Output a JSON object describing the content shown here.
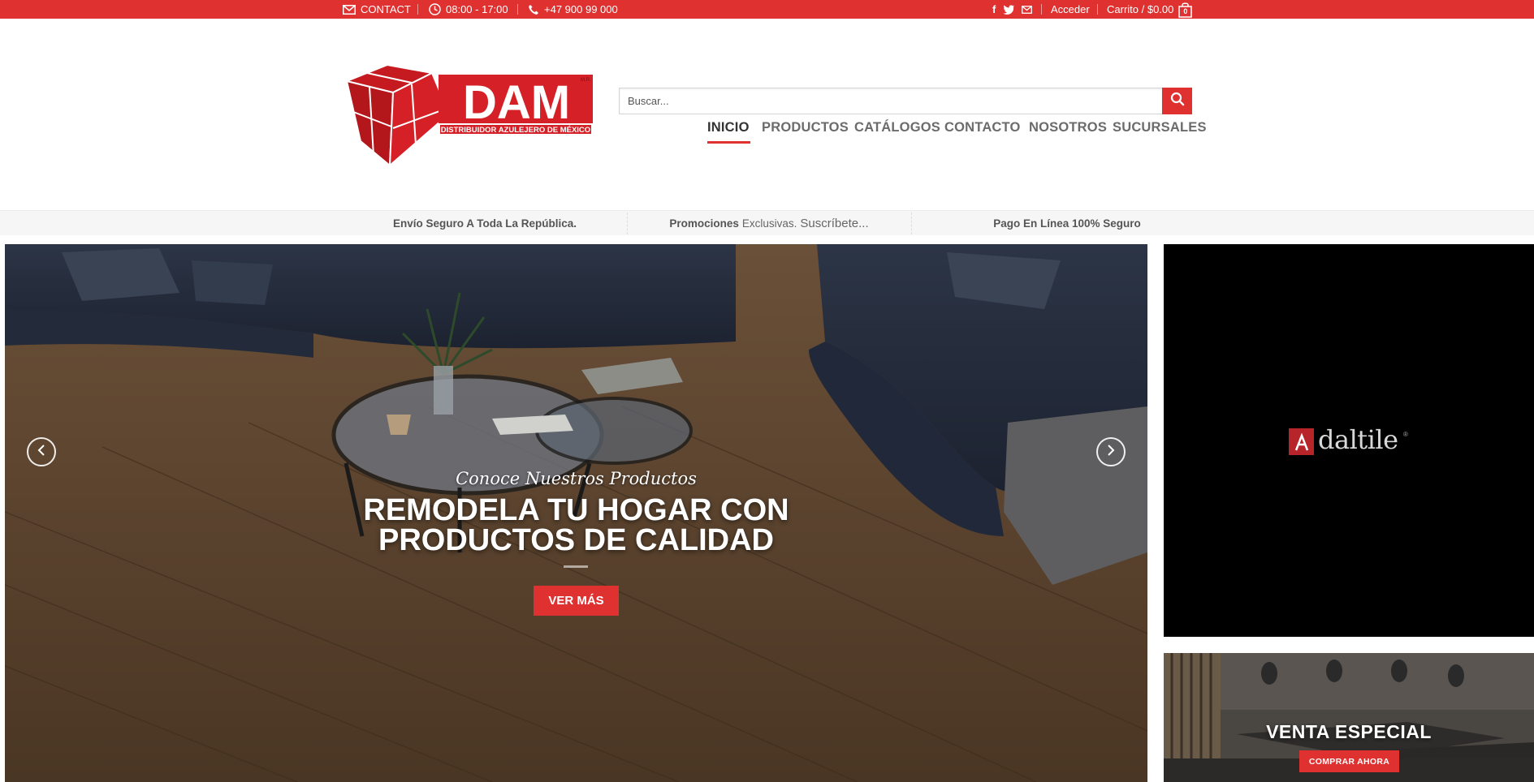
{
  "topbar": {
    "contact_label": "CONTACT",
    "hours": "08:00 - 17:00",
    "phone": "+47 900 99 000",
    "social_icons": [
      "facebook-icon",
      "twitter-icon",
      "envelope-icon"
    ],
    "login_label": "Acceder",
    "cart_label": "Carrito / $0.00",
    "cart_count": "0"
  },
  "header": {
    "logo": {
      "brand": "DAM",
      "mark": "M.R.",
      "tagline": "DISTRIBUIDOR AZULEJERO DE MÉXICO"
    },
    "search": {
      "placeholder": "Buscar..."
    },
    "nav": [
      {
        "label": "INICIO",
        "active": true
      },
      {
        "label": "PRODUCTOS"
      },
      {
        "label": "CATÁLOGOS"
      },
      {
        "label": "CONTACTO"
      },
      {
        "label": "NOSOTROS"
      },
      {
        "label": "SUCURSALES"
      }
    ]
  },
  "features": {
    "shipping": "Envío Seguro A Toda La República.",
    "promo_bold": "Promociones",
    "promo_text": "Exclusivas.",
    "promo_link": "Suscríbete...",
    "payment": "Pago En Línea 100% Seguro"
  },
  "hero": {
    "kicker": "Conoce Nuestros Productos",
    "headline_line1": "REMODELA TU HOGAR CON",
    "headline_line2": "PRODUCTOS DE CALIDAD",
    "cta_label": "VER MÁS"
  },
  "sidebar": {
    "brand_name": "daltile",
    "brand_reg": "®",
    "promo_title": "VENTA ESPECIAL",
    "promo_cta": "COMPRAR AHORA"
  },
  "colors": {
    "accent": "#e03131",
    "nav_text": "#6b6b6b",
    "brand_box_bg": "#000000"
  }
}
